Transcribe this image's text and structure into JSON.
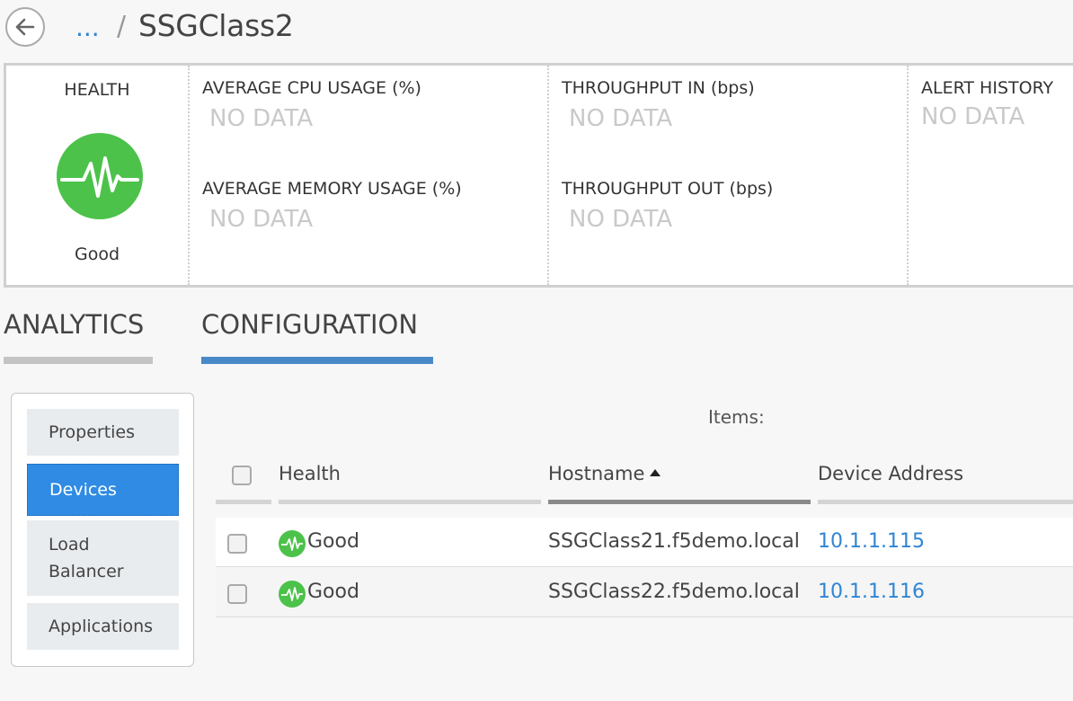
{
  "header": {
    "back_icon": "arrow-left-icon",
    "breadcrumb_ellipsis": "...",
    "breadcrumb_separator": "/",
    "title": "SSGClass2"
  },
  "summary": {
    "health_label": "HEALTH",
    "health_icon": "health-pulse-icon",
    "health_status": "Good",
    "health_color": "#4cc24a",
    "cpu_title": "AVERAGE CPU USAGE (%)",
    "cpu_value": "NO DATA",
    "memory_title": "AVERAGE MEMORY USAGE (%)",
    "memory_value": "NO DATA",
    "throughput_in_title": "THROUGHPUT IN (bps)",
    "throughput_in_value": "NO DATA",
    "throughput_out_title": "THROUGHPUT OUT (bps)",
    "throughput_out_value": "NO DATA",
    "alert_title": "ALERT HISTORY",
    "alert_value": "NO DATA"
  },
  "tabs": [
    {
      "label": "ANALYTICS",
      "active": false
    },
    {
      "label": "CONFIGURATION",
      "active": true
    }
  ],
  "sidenav": {
    "items": [
      {
        "label": "Properties",
        "active": false
      },
      {
        "label": "Devices",
        "active": true
      },
      {
        "label": "Load Balancer",
        "active": false
      },
      {
        "label": "Applications",
        "active": false
      }
    ]
  },
  "table": {
    "items_label": "Items:",
    "columns": [
      "Health",
      "Hostname",
      "Device Address"
    ],
    "sort_column": "Hostname",
    "sort_direction": "ascending",
    "rows": [
      {
        "health": "Good",
        "hostname": "SSGClass21.f5demo.local",
        "address": "10.1.1.115"
      },
      {
        "health": "Good",
        "hostname": "SSGClass22.f5demo.local",
        "address": "10.1.1.116"
      }
    ]
  },
  "colors": {
    "accent": "#2f8be3",
    "link": "#2f85d4",
    "tab_active_underline": "#4a89c7",
    "good": "#4cc24a"
  }
}
